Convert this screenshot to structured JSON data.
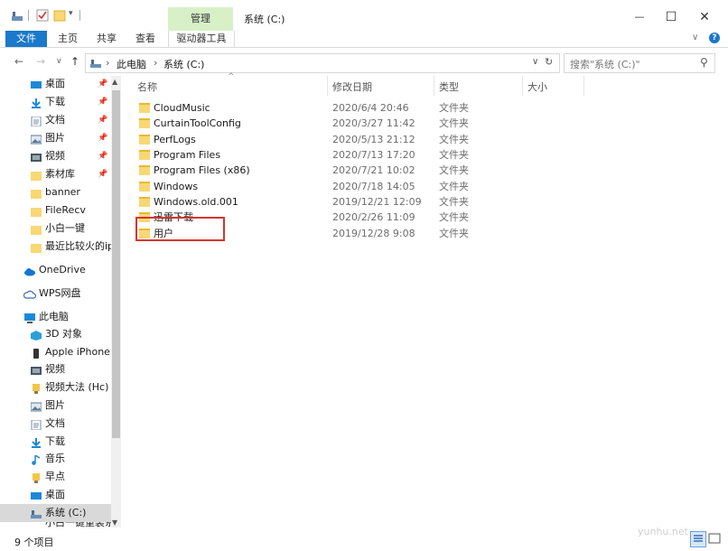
{
  "titlebar": {
    "ctx_tab": "管理",
    "title": "系统 (C:)",
    "minimize": "—",
    "maximize": "☐",
    "close": "✕"
  },
  "ribbon": {
    "tabs": [
      "文件",
      "主页",
      "共享",
      "查看"
    ],
    "drive_tools": "驱动器工具",
    "expand": "∨",
    "help": "?"
  },
  "address": {
    "back": "←",
    "forward": "→",
    "recent": "∨",
    "up": "↑",
    "crumbs": [
      "此电脑",
      "系统 (C:)"
    ],
    "sep": "›",
    "dropdown": "∨",
    "refresh": "↻",
    "search_placeholder": "搜索\"系统 (C:)\"",
    "search_icon": "⚲"
  },
  "nav": {
    "pinned": [
      {
        "label": "桌面",
        "icon": "desktop-icon"
      },
      {
        "label": "下载",
        "icon": "download-icon"
      },
      {
        "label": "文档",
        "icon": "document-icon"
      },
      {
        "label": "图片",
        "icon": "picture-icon"
      },
      {
        "label": "视频",
        "icon": "video-icon"
      },
      {
        "label": "素材库",
        "icon": "folder-icon"
      }
    ],
    "recent": [
      {
        "label": "banner"
      },
      {
        "label": "FileRecv"
      },
      {
        "label": "小白一键"
      },
      {
        "label": "最近比较火的ipl"
      }
    ],
    "onedrive": "OneDrive",
    "wps": "WPS网盘",
    "thispc": "此电脑",
    "pc_items": [
      {
        "label": "3D 对象",
        "icon": "3d-objects-icon"
      },
      {
        "label": "Apple iPhone",
        "icon": "phone-icon"
      },
      {
        "label": "视频",
        "icon": "video-icon"
      },
      {
        "label": "视频大法 (Hc)",
        "icon": "user-folder-icon"
      },
      {
        "label": "图片",
        "icon": "picture-icon"
      },
      {
        "label": "文档",
        "icon": "document-icon"
      },
      {
        "label": "下载",
        "icon": "download-icon"
      },
      {
        "label": "音乐",
        "icon": "music-icon"
      },
      {
        "label": "早点",
        "icon": "user-folder-icon"
      },
      {
        "label": "桌面",
        "icon": "desktop-icon"
      },
      {
        "label": "系统 (C:)",
        "icon": "drive-icon"
      }
    ],
    "partial": "小白一键重装系统"
  },
  "columns": {
    "name": "名称",
    "date": "修改日期",
    "type": "类型",
    "size": "大小",
    "sort": "^"
  },
  "files": [
    {
      "name": "CloudMusic",
      "date": "2020/6/4 20:46",
      "type": "文件夹"
    },
    {
      "name": "CurtainToolConfig",
      "date": "2020/3/27 11:42",
      "type": "文件夹"
    },
    {
      "name": "PerfLogs",
      "date": "2020/5/13 21:12",
      "type": "文件夹"
    },
    {
      "name": "Program Files",
      "date": "2020/7/13 17:20",
      "type": "文件夹"
    },
    {
      "name": "Program Files (x86)",
      "date": "2020/7/21 10:02",
      "type": "文件夹"
    },
    {
      "name": "Windows",
      "date": "2020/7/18 14:05",
      "type": "文件夹"
    },
    {
      "name": "Windows.old.001",
      "date": "2019/12/21 12:09",
      "type": "文件夹"
    },
    {
      "name": "迅雷下载",
      "date": "2020/2/26 11:09",
      "type": "文件夹"
    },
    {
      "name": "用户",
      "date": "2019/12/28 9:08",
      "type": "文件夹"
    }
  ],
  "status": {
    "count": "9 个项目"
  },
  "watermark": "yunhu.net",
  "colors": {
    "accent": "#1979ca",
    "highlight_box": "#d9332e",
    "folder": "#f8d775",
    "context_tab": "#d8f0c8"
  }
}
